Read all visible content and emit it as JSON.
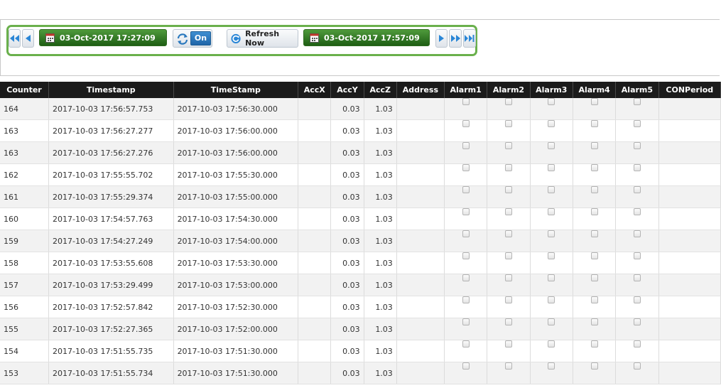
{
  "toolbar": {
    "start_date": "03-Oct-2017 17:27:09",
    "end_date": "03-Oct-2017 17:57:09",
    "auto_refresh_state": "On",
    "refresh_label": "Refresh Now",
    "icons": {
      "first": "double-left-arrow-icon",
      "prev": "left-arrow-icon",
      "calendar": "calendar-icon",
      "auto_refresh": "auto-refresh-icon",
      "refresh": "refresh-icon",
      "next": "right-arrow-icon",
      "forward": "double-right-arrow-icon",
      "last": "last-arrow-icon"
    },
    "colors": {
      "frame": "#6ab04c",
      "date_field": "#2f7a22",
      "on_button": "#2a78bd"
    }
  },
  "table": {
    "columns": [
      "Counter",
      "Timestamp",
      "TimeStamp",
      "AccX",
      "AccY",
      "AccZ",
      "Address",
      "Alarm1",
      "Alarm2",
      "Alarm3",
      "Alarm4",
      "Alarm5",
      "CONPeriod"
    ],
    "rows": [
      {
        "counter": "164",
        "timestamp": "2017-10-03 17:56:57.753",
        "time_stamp": "2017-10-03 17:56:30.000",
        "accx": "",
        "accy": "0.03",
        "accz": "1.03",
        "address": ""
      },
      {
        "counter": "163",
        "timestamp": "2017-10-03 17:56:27.277",
        "time_stamp": "2017-10-03 17:56:00.000",
        "accx": "",
        "accy": "0.03",
        "accz": "1.03",
        "address": ""
      },
      {
        "counter": "163",
        "timestamp": "2017-10-03 17:56:27.276",
        "time_stamp": "2017-10-03 17:56:00.000",
        "accx": "",
        "accy": "0.03",
        "accz": "1.03",
        "address": ""
      },
      {
        "counter": "162",
        "timestamp": "2017-10-03 17:55:55.702",
        "time_stamp": "2017-10-03 17:55:30.000",
        "accx": "",
        "accy": "0.03",
        "accz": "1.03",
        "address": ""
      },
      {
        "counter": "161",
        "timestamp": "2017-10-03 17:55:29.374",
        "time_stamp": "2017-10-03 17:55:00.000",
        "accx": "",
        "accy": "0.03",
        "accz": "1.03",
        "address": ""
      },
      {
        "counter": "160",
        "timestamp": "2017-10-03 17:54:57.763",
        "time_stamp": "2017-10-03 17:54:30.000",
        "accx": "",
        "accy": "0.03",
        "accz": "1.03",
        "address": ""
      },
      {
        "counter": "159",
        "timestamp": "2017-10-03 17:54:27.249",
        "time_stamp": "2017-10-03 17:54:00.000",
        "accx": "",
        "accy": "0.03",
        "accz": "1.03",
        "address": ""
      },
      {
        "counter": "158",
        "timestamp": "2017-10-03 17:53:55.608",
        "time_stamp": "2017-10-03 17:53:30.000",
        "accx": "",
        "accy": "0.03",
        "accz": "1.03",
        "address": ""
      },
      {
        "counter": "157",
        "timestamp": "2017-10-03 17:53:29.499",
        "time_stamp": "2017-10-03 17:53:00.000",
        "accx": "",
        "accy": "0.03",
        "accz": "1.03",
        "address": ""
      },
      {
        "counter": "156",
        "timestamp": "2017-10-03 17:52:57.842",
        "time_stamp": "2017-10-03 17:52:30.000",
        "accx": "",
        "accy": "0.03",
        "accz": "1.03",
        "address": ""
      },
      {
        "counter": "155",
        "timestamp": "2017-10-03 17:52:27.365",
        "time_stamp": "2017-10-03 17:52:00.000",
        "accx": "",
        "accy": "0.03",
        "accz": "1.03",
        "address": ""
      },
      {
        "counter": "154",
        "timestamp": "2017-10-03 17:51:55.735",
        "time_stamp": "2017-10-03 17:51:30.000",
        "accx": "",
        "accy": "0.03",
        "accz": "1.03",
        "address": ""
      },
      {
        "counter": "153",
        "timestamp": "2017-10-03 17:51:55.734",
        "time_stamp": "2017-10-03 17:51:30.000",
        "accx": "",
        "accy": "0.03",
        "accz": "1.03",
        "address": ""
      }
    ]
  }
}
